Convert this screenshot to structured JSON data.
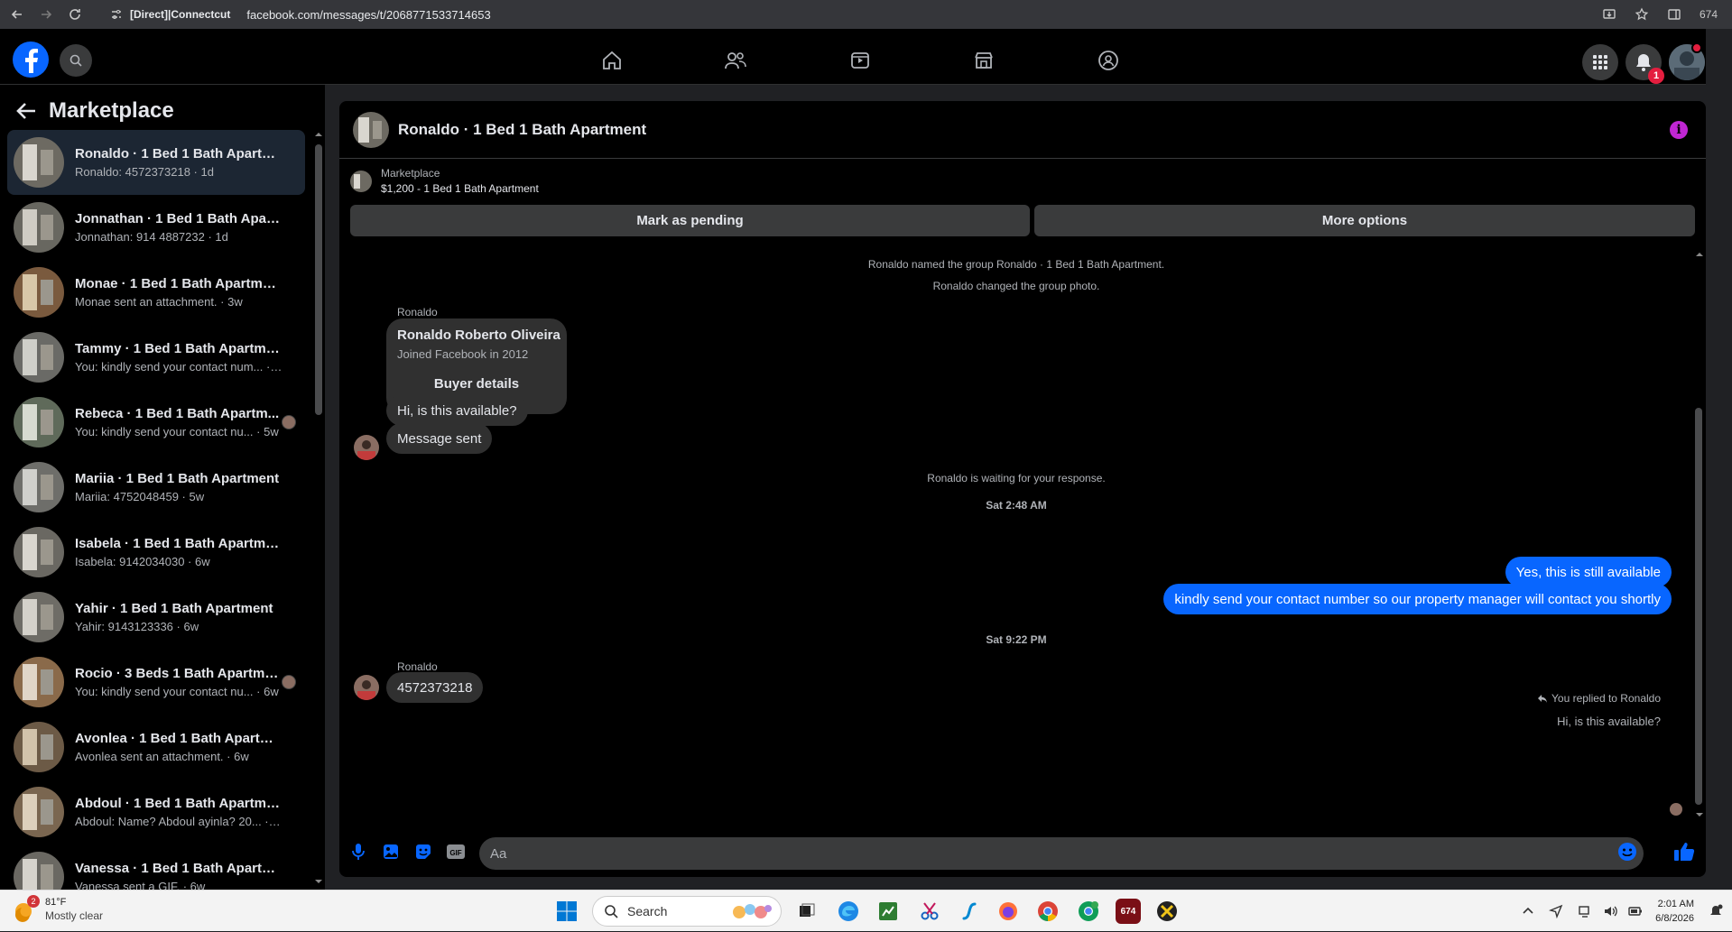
{
  "browser": {
    "site_label": "[Direct]|Connectcut",
    "url": "facebook.com/messages/t/2068771533714653",
    "ext_count": "674"
  },
  "fbnav": {
    "notification_count": "1"
  },
  "sidebar": {
    "title": "Marketplace",
    "conversations": [
      {
        "title": "Ronaldo · 1 Bed 1 Bath Apartment",
        "subtitle": "Ronaldo: 4572373218 · 1d",
        "active": true
      },
      {
        "title": "Jonnathan · 1 Bed 1 Bath Apartm...",
        "subtitle": "Jonnathan: 914 4887232 · 1d"
      },
      {
        "title": "Monae · 1 Bed 1 Bath Apartment",
        "subtitle": "Monae sent an attachment. · 3w"
      },
      {
        "title": "Tammy · 1 Bed 1 Bath Apartment",
        "subtitle": "You: kindly send your contact num... · 4w"
      },
      {
        "title": "Rebeca · 1 Bed 1 Bath Apartm...",
        "subtitle": "You: kindly send your contact nu... · 5w",
        "seen": true
      },
      {
        "title": "Mariia · 1 Bed 1 Bath Apartment",
        "subtitle": "Mariia: 4752048459 · 5w"
      },
      {
        "title": "Isabela · 1 Bed 1 Bath Apartment",
        "subtitle": "Isabela: 9142034030 · 6w"
      },
      {
        "title": "Yahir · 1 Bed 1 Bath Apartment",
        "subtitle": "Yahir: 9143123336 · 6w"
      },
      {
        "title": "Rocio · 3 Beds 1 Bath Apartme...",
        "subtitle": "You: kindly send your contact nu... · 6w",
        "seen": true
      },
      {
        "title": "Avonlea · 1 Bed 1 Bath Apartment",
        "subtitle": "Avonlea sent an attachment. · 6w"
      },
      {
        "title": "Abdoul · 1 Bed 1 Bath Apartment",
        "subtitle": "Abdoul: Name? Abdoul ayinla? 20... · 6w"
      },
      {
        "title": "Vanessa · 1 Bed 1 Bath Apartment",
        "subtitle": "Vanessa sent a GIF. · 6w"
      }
    ]
  },
  "chat": {
    "title": "Ronaldo · 1 Bed 1 Bath Apartment",
    "listing_source": "Marketplace",
    "listing_title": "$1,200 - 1 Bed 1 Bath Apartment",
    "mark_pending_label": "Mark as pending",
    "more_options_label": "More options",
    "system_named": "Ronaldo named the group Ronaldo · 1 Bed 1 Bath Apartment.",
    "system_photo": "Ronaldo changed the group photo.",
    "sender_name": "Ronaldo",
    "buyer_name": "Ronaldo Roberto Oliveira",
    "buyer_joined": "Joined Facebook in 2012",
    "buyer_details_label": "Buyer details",
    "msg_available": "Hi, is this available?",
    "msg_sent": "Message sent",
    "waiting_text": "Ronaldo is waiting for your response.",
    "time1": "Sat 2:48 AM",
    "replied_note": "You replied to Ronaldo",
    "quoted_text": "Hi, is this available?",
    "reply1": "Yes, this is still available",
    "reply2": "kindly send your contact number so our property manager will contact you shortly",
    "time2": "Sat 9:22 PM",
    "sender_name2": "Ronaldo",
    "msg_number": "4572373218",
    "composer_placeholder": "Aa"
  },
  "taskbar": {
    "weather_badge": "2",
    "temperature": "81°F",
    "condition": "Mostly clear",
    "search_label": "Search",
    "time": "2:01 AM",
    "date": "6/8/2026",
    "app_badge": "674"
  },
  "colors": {
    "accent": "#0866ff",
    "info": "#c026d3",
    "badge": "#e41e3f"
  }
}
